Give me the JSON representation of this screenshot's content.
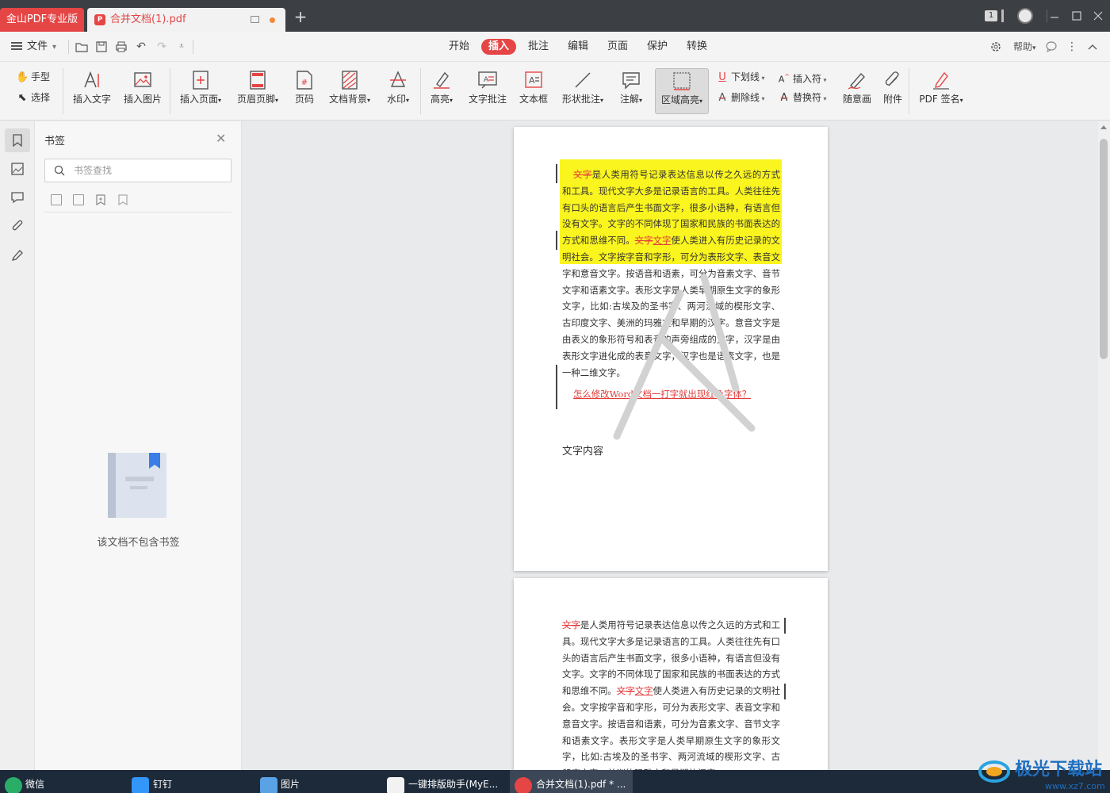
{
  "titlebar": {
    "app_tab": "金山PDF专业版",
    "doc_tab": "合并文档(1).pdf",
    "page_badge": "1",
    "new_tab": "+"
  },
  "menubar": {
    "file": "文件",
    "tabs": [
      "开始",
      "插入",
      "批注",
      "编辑",
      "页面",
      "保护",
      "转换"
    ],
    "active_tab": "插入",
    "help": "帮助"
  },
  "ribbon": {
    "hand": "手型",
    "select": "选择",
    "insert_text": "插入文字",
    "insert_image": "插入图片",
    "insert_page": "插入页面",
    "header_footer": "页眉页脚",
    "page_number": "页码",
    "doc_background": "文档背景",
    "watermark": "水印",
    "highlight": "高亮",
    "text_annotation": "文字批注",
    "text_box": "文本框",
    "shape_annotation": "形状批注",
    "note": "注解",
    "area_highlight": "区域高亮",
    "underline": "下划线",
    "insert_symbol": "插入符",
    "strikethrough": "删除线",
    "replace_symbol": "替换符",
    "freehand": "随意画",
    "attachment": "附件",
    "pdf_sign": "PDF 签名"
  },
  "bookmark_panel": {
    "title": "书签",
    "search_placeholder": "书签查找",
    "empty_message": "该文档不包含书签"
  },
  "page1": {
    "strike_word": "文字",
    "highlight_text_a": "是人类用符号记录表达信息以传之久远的方式和工具。现代文字大多是记录语言的工具。人类往往先有口头的语言后产生书面文字，很多小语种，有语言但没有文字。文字的不同体现了国家和民族的书面表达的方式和思维不同。",
    "strike_word_2": "文字",
    "underline_word": "文字",
    "highlight_text_b": "使人类进入有历史记录的文明社会。",
    "body_text": "文字按字音和字形，可分为表形文字、表音文字和意音文字。按语音和语素，可分为音素文字、音节文字和语素文字。表形文字是人类早期原生文字的象形文字，比如:古埃及的圣书字、两河流域的楔形文字、古印度文字、美洲的玛雅文和早期的汉字。意音文字是由表义的象形符号和表音的声旁组成的文字，汉字是由表形文字进化成的表意文字，汉字也是语素文字，也是一种二维文字。",
    "link_text": "怎么修改Word文档一打字就出现红色字体？",
    "content_label": "文字内容"
  },
  "page2": {
    "strike_word": "文字",
    "text_a": "是人类用符号记录表达信息以传之久远的方式和工具。现代文字大多是记录语言的工具。人类往往先有口头的语言后产生书面文字，很多小语种，有语言但没有文字。文字的不同体现了国家和民族的书面表达的方式和思维不同。",
    "strike_word_2": "文字",
    "underline_word": "文字",
    "text_b": "使人类进入有历史记录的文明社会。文字按字音和字形，可分为表形文字、表音文字和意音文字。按语音和语素，可分为音素文字、音节文字和语素文字。表形文字是人类早期原生文字的象形文字，比如:古埃及的圣书字、两河流域的楔形文字、古印度文字、美洲的玛雅文和早期的汉字。"
  },
  "taskbar": {
    "items": [
      "微信",
      "钉钉",
      "图片",
      "一键排版助手(MyE...",
      "合并文档(1).pdf * ..."
    ]
  },
  "colors": {
    "accent": "#e64545",
    "highlight": "#fbf51f",
    "titlebar": "#3c3f44",
    "taskbar": "#1d2a3a"
  }
}
